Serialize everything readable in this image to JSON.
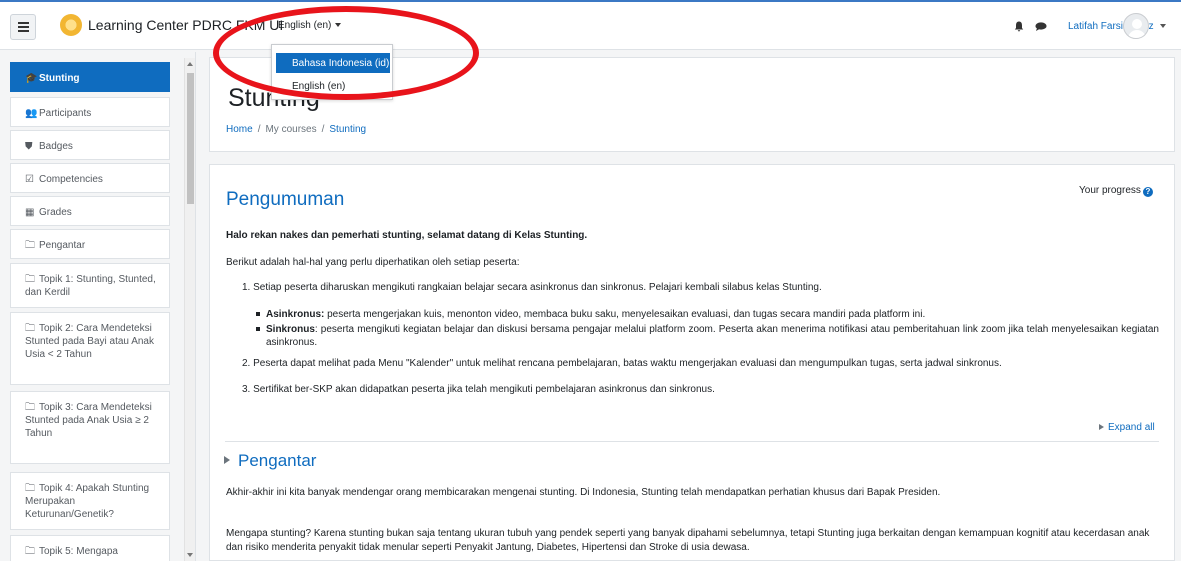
{
  "topbar": {
    "site_name": "Learning Center PDRC FKM UI",
    "language_current": "English (en)",
    "language_options": [
      "Bahasa Indonesia (id)",
      "English (en)"
    ],
    "user_name": "Latifah Farsia, SGz",
    "icons": [
      "menu-icon",
      "bell-icon",
      "chat-icon",
      "avatar",
      "chevron-down-icon"
    ]
  },
  "sidebar": {
    "items": [
      {
        "label": "Stunting",
        "icon": "graduation-cap-icon",
        "active": true
      },
      {
        "label": "Participants",
        "icon": "users-icon"
      },
      {
        "label": "Badges",
        "icon": "shield-icon"
      },
      {
        "label": "Competencies",
        "icon": "checkbox-icon"
      },
      {
        "label": "Grades",
        "icon": "table-icon"
      },
      {
        "label": "Pengantar",
        "icon": "folder-icon"
      },
      {
        "label": "Topik 1: Stunting, Stunted, dan Kerdil",
        "icon": "folder-icon"
      },
      {
        "label": "Topik 2: Cara Mendeteksi Stunted pada Bayi atau Anak Usia < 2 Tahun",
        "icon": "folder-icon"
      },
      {
        "label": "Topik 3: Cara Mendeteksi Stunted pada Anak Usia ≥ 2 Tahun",
        "icon": "folder-icon"
      },
      {
        "label": "Topik 4: Apakah Stunting Merupakan Keturunan/Genetik?",
        "icon": "folder-icon"
      },
      {
        "label": "Topik 5: Mengapa",
        "icon": "folder-icon"
      }
    ]
  },
  "header": {
    "title": "Stunting",
    "breadcrumb": [
      "Home",
      "My courses",
      "Stunting"
    ]
  },
  "main": {
    "section_title": "Pengumuman",
    "progress_label": "Your progress",
    "greeting": "Halo rekan nakes dan pemerhati stunting, selamat datang di Kelas Stunting.",
    "intro": "Berikut adalah hal-hal yang perlu diperhatikan oleh setiap peserta:",
    "item_1": "1. Setiap peserta diharuskan mengikuti rangkaian belajar secara asinkronus dan sinkronus. Pelajari kembali silabus kelas Stunting.",
    "bullet_1_term": "Asinkronus:",
    "bullet_1_text": " peserta mengerjakan kuis, menonton video, membaca buku saku, menyelesaikan evaluasi, dan tugas secara mandiri pada platform ini.",
    "bullet_2_term": "Sinkronus",
    "bullet_2_text": ": peserta mengikuti kegiatan belajar dan diskusi bersama pengajar melalui platform zoom. Peserta akan menerima notifikasi atau pemberitahuan link zoom jika telah menyelesaikan kegiatan asinkronus.",
    "item_2": "2. Peserta dapat melihat pada Menu \"Kalender\" untuk melihat rencana pembelajaran, batas waktu mengerjakan evaluasi dan mengumpulkan tugas, serta jadwal sinkronus.",
    "item_3": "3. Sertifikat ber-SKP akan didapatkan peserta jika telah mengikuti pembelajaran asinkronus dan sinkronus.",
    "expand_all": "Expand all",
    "subsection_title": "Pengantar",
    "para_1": "Akhir-akhir ini kita banyak mendengar orang membicarakan mengenai stunting. Di Indonesia, Stunting telah mendapatkan perhatian khusus dari Bapak Presiden.",
    "para_2": "Mengapa stunting? Karena stunting bukan saja tentang ukuran tubuh yang pendek seperti yang banyak dipahami sebelumnya, tetapi Stunting juga berkaitan dengan kemampuan kognitif atau kecerdasan anak dan risiko menderita penyakit tidak menular seperti Penyakit Jantung, Diabetes, Hipertensi dan Stroke di usia dewasa."
  },
  "colors": {
    "accent": "#0f6cbf",
    "annotation": "#e8141b",
    "topbar_border": "#3b78c4"
  }
}
